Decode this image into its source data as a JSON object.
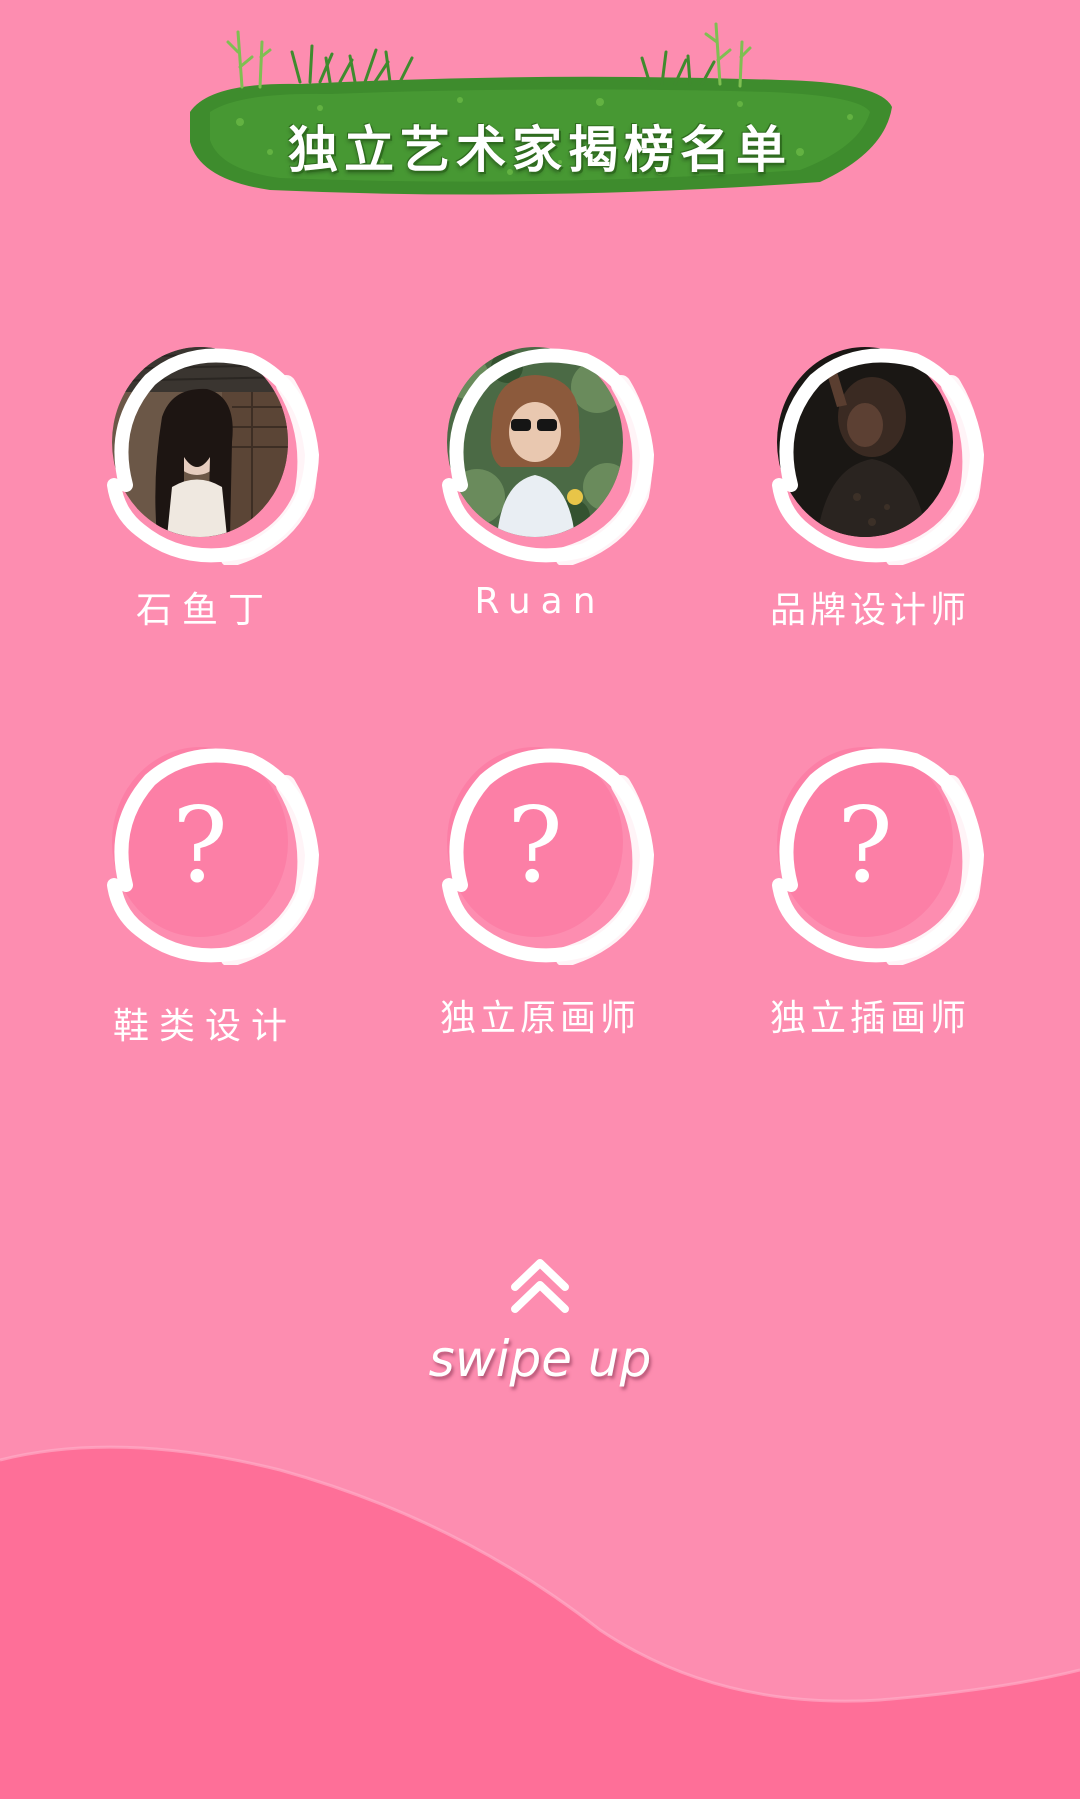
{
  "banner": {
    "title": "独立艺术家揭榜名单"
  },
  "artists": [
    {
      "name": "石鱼丁",
      "revealed": true,
      "photo_tone": "#5a4a3c"
    },
    {
      "name": "Ruan",
      "revealed": true,
      "photo_tone": "#4f6f4a"
    },
    {
      "name": "品牌设计师",
      "revealed": true,
      "photo_tone": "#1c1a18"
    },
    {
      "name": "鞋类设计",
      "revealed": false,
      "placeholder": "?"
    },
    {
      "name": "独立原画师",
      "revealed": false,
      "placeholder": "?"
    },
    {
      "name": "独立插画师",
      "revealed": false,
      "placeholder": "?"
    }
  ],
  "swipe": {
    "label": "swipe up",
    "icon": "double-chevron-up-icon"
  },
  "colors": {
    "background": "#fd8db0",
    "wave": "#fe6f98",
    "grass": "#3f8b2e",
    "text": "#ffffff"
  }
}
